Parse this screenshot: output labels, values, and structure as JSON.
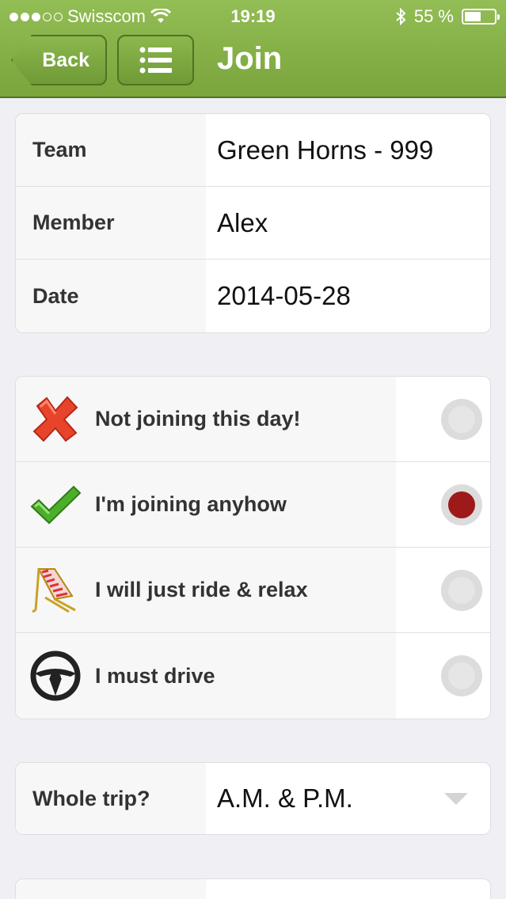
{
  "status": {
    "carrier": "Swisscom",
    "time": "19:19",
    "battery": "55 %",
    "battery_level": 0.55
  },
  "nav": {
    "back_label": "Back",
    "title": "Join"
  },
  "info": [
    {
      "label": "Team",
      "value": "Green Horns - 999"
    },
    {
      "label": "Member",
      "value": "Alex"
    },
    {
      "label": "Date",
      "value": "2014-05-28"
    }
  ],
  "options": [
    {
      "label": "Not joining this day!",
      "icon": "red-x-icon",
      "selected": false
    },
    {
      "label": "I'm joining anyhow",
      "icon": "green-check-icon",
      "selected": true
    },
    {
      "label": "I will just ride & relax",
      "icon": "deck-chair-icon",
      "selected": false
    },
    {
      "label": "I must drive",
      "icon": "steering-wheel-icon",
      "selected": false
    }
  ],
  "trip": {
    "label": "Whole trip?",
    "value": "A.M. & P.M."
  },
  "colors": {
    "header": "#86b049",
    "selected_radio": "#9e1a1a"
  }
}
